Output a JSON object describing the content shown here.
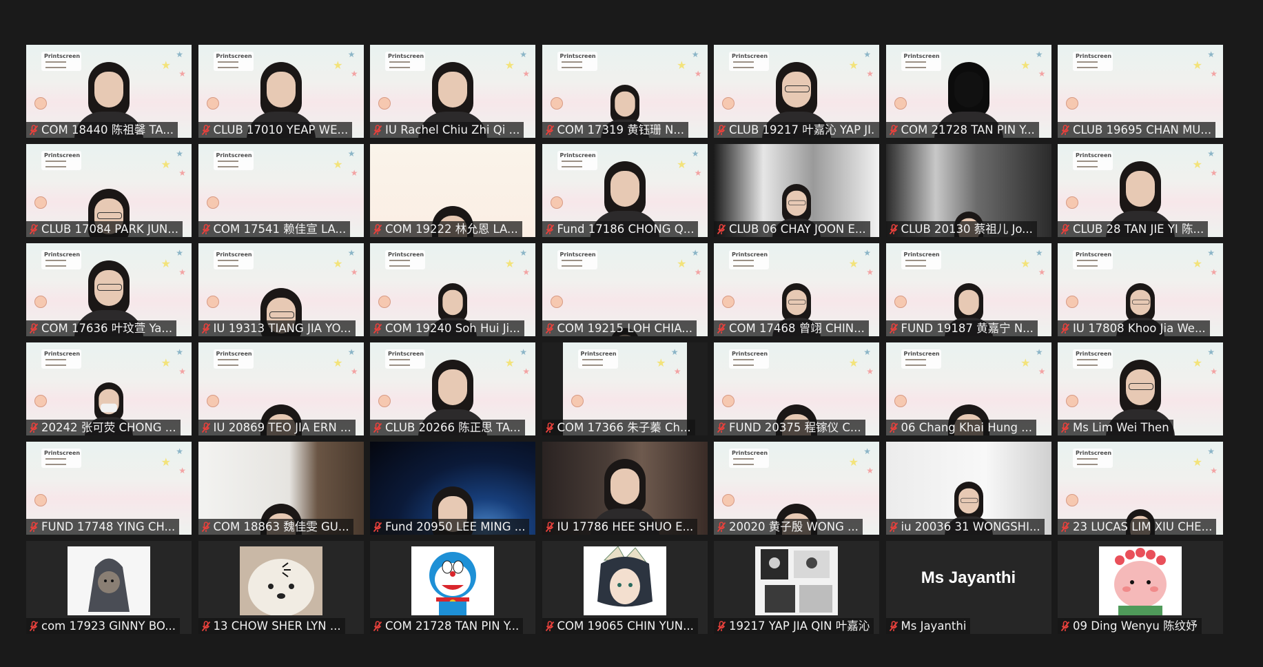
{
  "meeting": {
    "logo_text": "Printscreen",
    "avatar_text": "Ms Jayanthi",
    "muted_icon_color": "#e8413c",
    "participants": [
      {
        "name": "COM 18440 陈祖馨 TA..."
      },
      {
        "name": "CLUB 17010 YEAP WE..."
      },
      {
        "name": "IU Rachel Chiu Zhi Qi ..."
      },
      {
        "name": "COM 17319 黄钰珊 N..."
      },
      {
        "name": "CLUB 19217 叶嘉沁 YAP JI..."
      },
      {
        "name": "COM 21728 TAN PIN Y..."
      },
      {
        "name": "CLUB 19695 CHAN MU..."
      },
      {
        "name": "CLUB 17084 PARK JUN..."
      },
      {
        "name": "COM 17541 赖佳宣 LA..."
      },
      {
        "name": "COM 19222 林允恩 LA..."
      },
      {
        "name": "Fund 17186 CHONG Q..."
      },
      {
        "name": "CLUB 06 CHAY JOON E..."
      },
      {
        "name": "CLUB 20130 蔡祖儿 Jo..."
      },
      {
        "name": "CLUB 28 TAN JIE YI 陈..."
      },
      {
        "name": "COM 17636 叶玟萱 Ya..."
      },
      {
        "name": "IU 19313 TIANG JIA YO..."
      },
      {
        "name": "COM 19240 Soh Hui Ji..."
      },
      {
        "name": "COM 19215 LOH CHIA..."
      },
      {
        "name": "COM 17468 曾翊 CHIN..."
      },
      {
        "name": "FUND 19187 黄嘉宁 N..."
      },
      {
        "name": "IU 17808 Khoo Jia We..."
      },
      {
        "name": "20242 张可荧 CHONG ..."
      },
      {
        "name": "IU 20869 TEO JIA ERN ..."
      },
      {
        "name": "CLUB 20266 陈正思 TA..."
      },
      {
        "name": "COM 17366 朱子蓁 Ch..."
      },
      {
        "name": "FUND 20375 程镓仪 C..."
      },
      {
        "name": "06 Chang Khai Hung ..."
      },
      {
        "name": "Ms Lim Wei Then"
      },
      {
        "name": "FUND 17748 YING CH..."
      },
      {
        "name": "COM 18863 魏佳雯 GU..."
      },
      {
        "name": "Fund 20950 LEE MING ..."
      },
      {
        "name": "IU 17786 HEE SHUO E..."
      },
      {
        "name": "20020 黄子殷 WONG ..."
      },
      {
        "name": "iu 20036 31 WONGSHI..."
      },
      {
        "name": "23 LUCAS LIM XIU CHE..."
      },
      {
        "name": "com 17923 GINNY BO..."
      },
      {
        "name": "13 CHOW SHER LYN ..."
      },
      {
        "name": "COM 21728 TAN PIN Y..."
      },
      {
        "name": "COM 19065 CHIN YUN..."
      },
      {
        "name": "19217 YAP JIA QIN 叶嘉沁"
      },
      {
        "name": "Ms Jayanthi"
      },
      {
        "name": "09 Ding Wenyu 陈纹妤"
      }
    ]
  }
}
